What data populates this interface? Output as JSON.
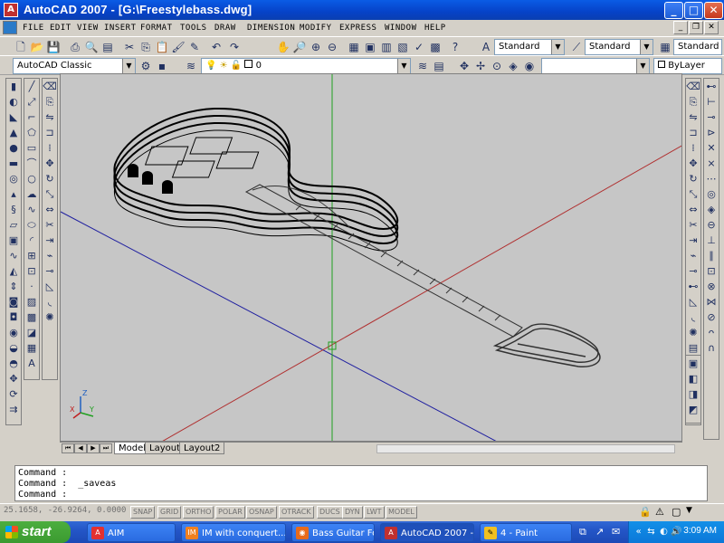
{
  "window": {
    "title": "AutoCAD 2007 - [G:\\Freestylebass.dwg]",
    "min": "_",
    "max": "□",
    "close": "✕"
  },
  "menu": {
    "items": [
      "FILE",
      "EDIT",
      "VIEW",
      "INSERT",
      "FORMAT",
      "TOOLS",
      "DRAW",
      "DIMENSION",
      "MODIFY",
      "EXPRESS",
      "WINDOW",
      "HELP"
    ]
  },
  "toolbar": {
    "text_style": "Standard",
    "dim_style": "Standard",
    "table_style": "Standard",
    "workspace": "AutoCAD Classic",
    "layer": "0",
    "color": "ByLayer"
  },
  "tabs": {
    "model": "Model",
    "layout1": "Layout1",
    "layout2": "Layout2"
  },
  "command": {
    "line1": "Command :",
    "line2": "Command :  _saveas",
    "line3": "Command :"
  },
  "status": {
    "coords": "25.1658, -26.9264, 0.0000",
    "buttons": [
      "SNAP",
      "GRID",
      "ORTHO",
      "POLAR",
      "OSNAP",
      "OTRACK",
      "DUCS",
      "DYN",
      "LWT",
      "MODEL"
    ]
  },
  "ucs": {
    "x": "X",
    "y": "Y",
    "z": "Z"
  },
  "taskbar": {
    "start": "start",
    "items": [
      {
        "label": "AIM",
        "icon_color": "#e23030"
      },
      {
        "label": "IM with conquert...",
        "icon_color": "#f08020"
      },
      {
        "label": "Bass Guitar Foru...",
        "icon_color": "#e86a1a"
      },
      {
        "label": "AutoCAD 2007 - ...",
        "icon_color": "#c03030"
      },
      {
        "label": "4 - Paint",
        "icon_color": "#f0c020"
      }
    ],
    "clock": "3:09 AM"
  },
  "colors": {
    "axis_red": "#b03030",
    "axis_blue": "#2020a0",
    "axis_green": "#20a020",
    "viewport_bg": "#c6c6c6"
  }
}
